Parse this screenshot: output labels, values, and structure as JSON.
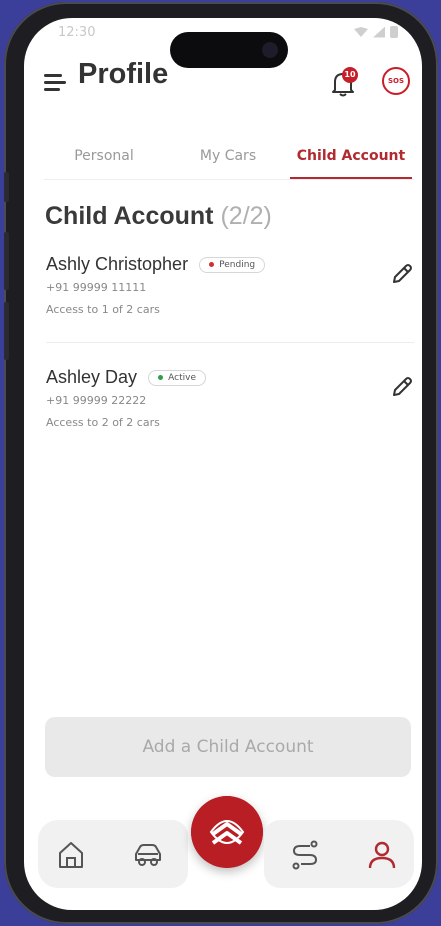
{
  "status_bar": {
    "time": "12:30"
  },
  "header": {
    "title": "Profile",
    "notification_count": "10",
    "sos_label": "SOS"
  },
  "tabs": [
    {
      "label": "Personal"
    },
    {
      "label": "My Cars"
    },
    {
      "label": "Child Account"
    }
  ],
  "section": {
    "title": "Child Account",
    "count": "(2/2)"
  },
  "accounts": [
    {
      "name": "Ashly Christopher",
      "status": "Pending",
      "phone": "+91 99999 11111",
      "access": "Access to 1 of 2 cars"
    },
    {
      "name": "Ashley Day",
      "status": "Active",
      "phone": "+91 99999 22222",
      "access": "Access to 2 of 2 cars"
    }
  ],
  "add_button": {
    "label": "Add a Child Account"
  },
  "colors": {
    "accent": "#b22a2f",
    "pending": "#d32f2f",
    "active": "#2e9e4a",
    "background": "#3b3f9a"
  },
  "icons": {
    "menu": "menu-icon",
    "notifications": "bell-icon",
    "edit": "pencil-icon",
    "nav": [
      "home-icon",
      "car-icon",
      "brand-logo-icon",
      "route-icon",
      "profile-icon"
    ]
  }
}
